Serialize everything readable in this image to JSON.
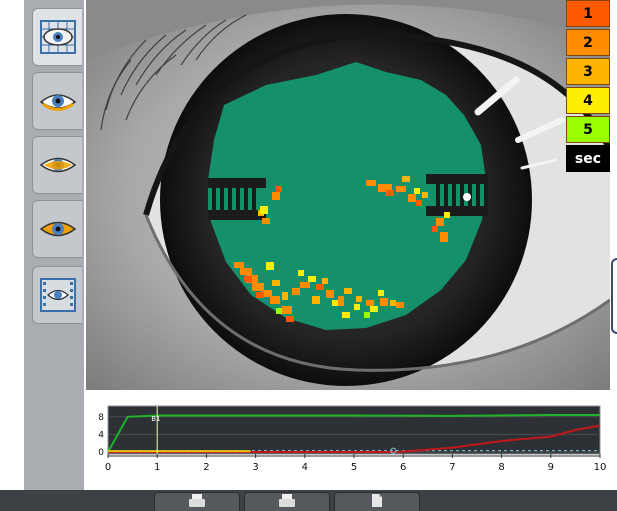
{
  "sidebar": {
    "buttons": [
      {
        "name": "eye-grid-view",
        "icon": "eye-grid-icon",
        "active": true
      },
      {
        "name": "eye-upper-view",
        "icon": "eye-upper-icon",
        "active": false
      },
      {
        "name": "eye-middle-view",
        "icon": "eye-middle-icon",
        "active": false
      },
      {
        "name": "eye-lower-view",
        "icon": "eye-lower-icon",
        "active": false
      },
      {
        "name": "eye-film-view",
        "icon": "eye-film-icon",
        "active": false
      }
    ]
  },
  "scale": {
    "levels": [
      {
        "label": "1",
        "color": "#ff5a00"
      },
      {
        "label": "2",
        "color": "#ff8c00"
      },
      {
        "label": "3",
        "color": "#ffb400"
      },
      {
        "label": "4",
        "color": "#ffee00"
      },
      {
        "label": "5",
        "color": "#99ff00"
      }
    ],
    "unit_label": "sec"
  },
  "overlay_color": "#14906b",
  "chart_data": {
    "type": "line",
    "xlim": [
      0,
      10
    ],
    "ylim": [
      0,
      10
    ],
    "x_ticks": [
      "0",
      "1",
      "2",
      "3",
      "4",
      "5",
      "6",
      "7",
      "8",
      "9",
      "10"
    ],
    "y_ticks": [
      "8",
      "4",
      "0"
    ],
    "marker_label": "B1",
    "marker_x": 1,
    "series": [
      {
        "color": "#1fb32a",
        "x": [
          0,
          0.4,
          1,
          3,
          5,
          7,
          9,
          10
        ],
        "y": [
          0,
          8,
          8.3,
          8.3,
          8.3,
          8.2,
          8.4,
          8.4
        ]
      },
      {
        "color": "#c01818",
        "x": [
          0,
          5.9,
          7,
          8,
          9,
          9.5,
          10
        ],
        "y": [
          0,
          0,
          1,
          2.5,
          3.5,
          5,
          6
        ]
      },
      {
        "color": "#e8c000",
        "x": [
          0,
          1,
          2.9
        ],
        "y": [
          0.2,
          0.2,
          0.2
        ]
      }
    ],
    "dashed_line_y": 0.3
  },
  "bottom_bar": {
    "buttons": [
      {
        "name": "print-button-1",
        "icon": "printer-icon"
      },
      {
        "name": "print-button-2",
        "icon": "printer-icon"
      },
      {
        "name": "export-button",
        "icon": "document-icon"
      }
    ]
  }
}
